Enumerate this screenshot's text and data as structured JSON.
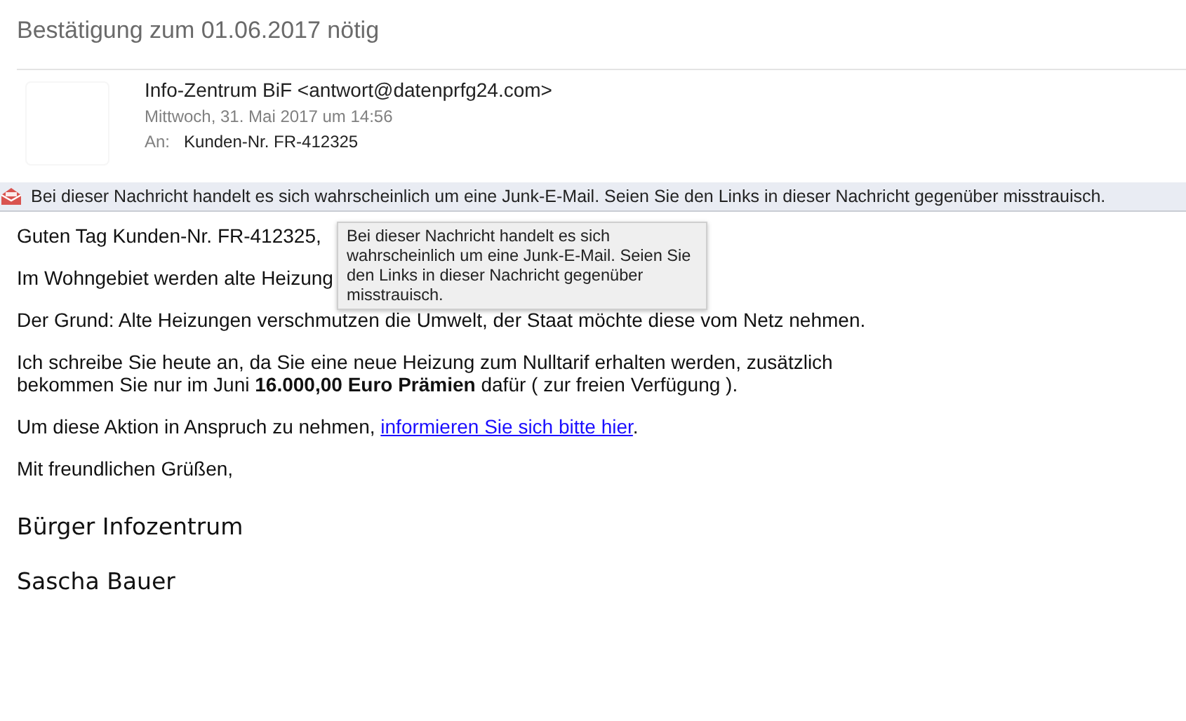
{
  "subject": "Bestätigung zum 01.06.2017 nötig",
  "header": {
    "sender": "Info-Zentrum BiF <antwort@datenprfg24.com>",
    "date": "Mittwoch, 31. Mai 2017 um 14:56",
    "to_label": "An:",
    "to": "Kunden-Nr. FR-412325"
  },
  "junk_banner": {
    "text": "Bei dieser Nachricht handelt es sich wahrscheinlich um eine Junk-E-Mail. Seien Sie den Links in dieser Nachricht gegenüber misstrauisch."
  },
  "body": [
    {
      "kind": "text",
      "text": "Guten Tag Kunden-Nr. FR-412325,"
    },
    {
      "kind": "text",
      "text": "Im Wohngebiet werden alte Heizung"
    },
    {
      "kind": "text",
      "text": "Der Grund: Alte Heizungen verschmutzen die Umwelt, der Staat möchte diese vom Netz nehmen."
    },
    {
      "kind": "text",
      "text": "Ich schreibe Sie heute an, da Sie eine neue Heizung zum Nulltarif erhalten werden, zusätzlich bekommen Sie nur im Juni **16.000,00 Euro Prämien** dafür ( zur freien Verfügung )."
    },
    {
      "kind": "link",
      "text": "Um diese Aktion in Anspruch zu nehmen, ",
      "link": "informieren Sie sich bitte hier",
      "after": "."
    },
    {
      "kind": "text",
      "text": "Mit freundlichen Grüßen,"
    },
    {
      "kind": "signature",
      "text": "Bürger Infozentrum"
    },
    {
      "kind": "signature",
      "text": "Sascha Bauer"
    }
  ],
  "tooltip": {
    "text": "Bei dieser Nachricht handelt es sich wahrscheinlich um eine Junk-E-Mail. Seien Sie den Links in dieser Nachricht gegenüber misstrauisch."
  }
}
